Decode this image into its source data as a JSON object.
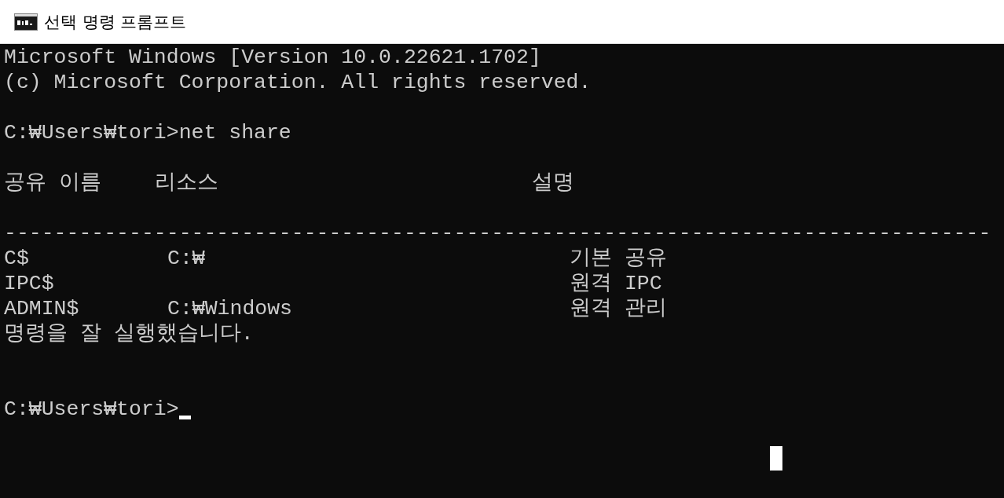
{
  "window": {
    "title": "선택 명령 프롬프트"
  },
  "console": {
    "lines": [
      {
        "kind": "text",
        "text": "Microsoft Windows [Version 10.0.22621.1702]"
      },
      {
        "kind": "text",
        "text": "(c) Microsoft Corporation. All rights reserved."
      },
      {
        "kind": "blank"
      },
      {
        "kind": "text",
        "text": "C:₩Users₩tori>net share"
      },
      {
        "kind": "blank"
      },
      {
        "kind": "header",
        "columns": [
          "공유 이름",
          "리소스",
          "설명"
        ]
      },
      {
        "kind": "blank"
      },
      {
        "kind": "separator",
        "text": "-------------------------------------------------------------------------------"
      },
      {
        "kind": "row",
        "name": "C$",
        "resource": "C:₩",
        "remark": "기본 공유"
      },
      {
        "kind": "row",
        "name": "IPC$",
        "remark": "원격 IPC"
      },
      {
        "kind": "row",
        "name": "ADMIN$",
        "resource": "C:₩Windows",
        "remark": "원격 관리"
      },
      {
        "kind": "text",
        "text": "명령을 잘 실행했습니다."
      },
      {
        "kind": "blank"
      },
      {
        "kind": "blank"
      },
      {
        "kind": "prompt",
        "text": "C:₩Users₩tori>"
      }
    ]
  }
}
